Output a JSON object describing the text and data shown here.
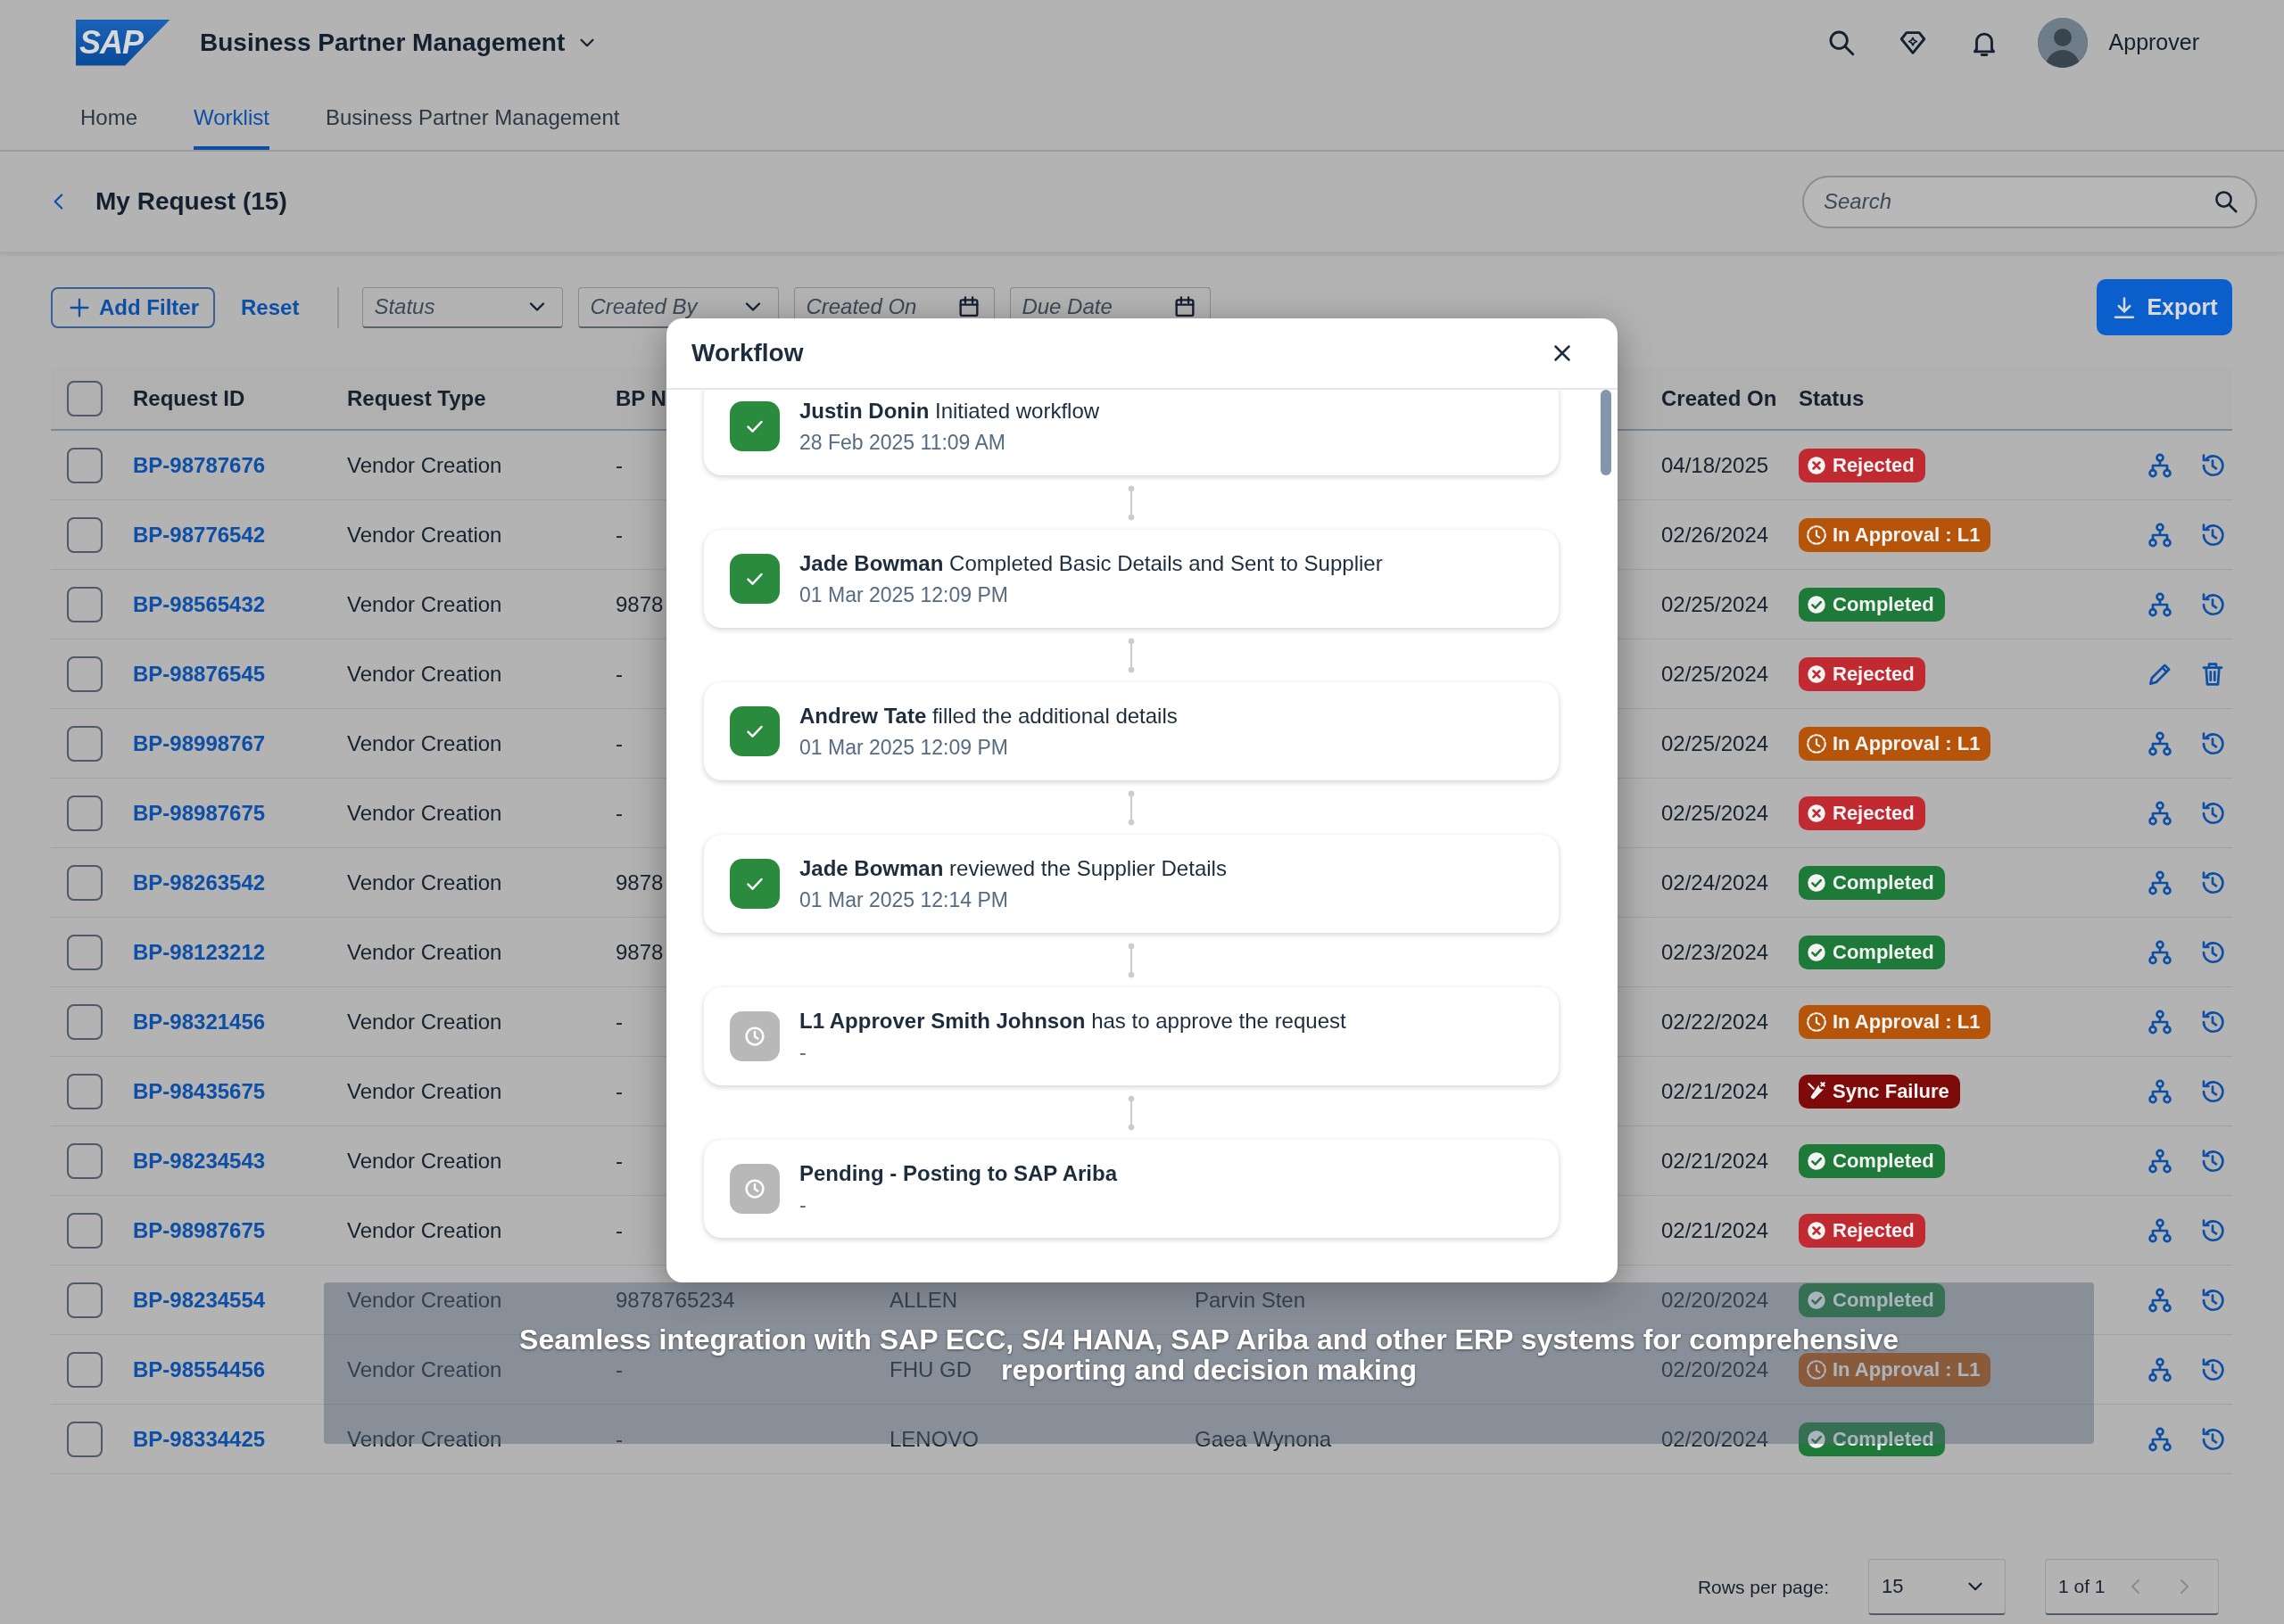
{
  "app": {
    "logo": "SAP",
    "title": "Business Partner Management",
    "user": "Approver"
  },
  "nav_tabs": [
    {
      "label": "Home",
      "selected": false
    },
    {
      "label": "Worklist",
      "selected": true
    },
    {
      "label": "Business Partner Management",
      "selected": false
    }
  ],
  "page": {
    "title": "My Request (15)"
  },
  "search": {
    "placeholder": "Search"
  },
  "filters": {
    "add_filter": "Add Filter",
    "reset": "Reset",
    "export": "Export",
    "fields": [
      {
        "kind": "select",
        "placeholder": "Status"
      },
      {
        "kind": "select",
        "placeholder": "Created By"
      },
      {
        "kind": "date",
        "placeholder": "Created On"
      },
      {
        "kind": "date",
        "placeholder": "Due Date"
      }
    ]
  },
  "table": {
    "all_checked": false,
    "columns": {
      "request_id": "Request ID",
      "request_type": "Request Type",
      "column_3": "BP N",
      "created_on": "Created On",
      "status": "Status"
    },
    "rows": [
      {
        "checked": false,
        "request_id": "BP-98787676",
        "request_type": "Vendor Creation",
        "column_3": "-",
        "created_on": "04/18/2025",
        "status": {
          "label": "Rejected",
          "kind": "rejected"
        },
        "actions": [
          {
            "kind": "hierarchy"
          },
          {
            "kind": "history"
          }
        ]
      },
      {
        "checked": false,
        "request_id": "BP-98776542",
        "request_type": "Vendor Creation",
        "column_3": "-",
        "created_on": "02/26/2024",
        "status": {
          "label": "In Approval : L1",
          "kind": "in_approval"
        },
        "actions": [
          {
            "kind": "hierarchy"
          },
          {
            "kind": "history"
          }
        ]
      },
      {
        "checked": false,
        "request_id": "BP-98565432",
        "request_type": "Vendor Creation",
        "column_3": "9878",
        "created_on": "02/25/2024",
        "status": {
          "label": "Completed",
          "kind": "completed"
        },
        "actions": [
          {
            "kind": "hierarchy"
          },
          {
            "kind": "history"
          }
        ]
      },
      {
        "checked": false,
        "request_id": "BP-98876545",
        "request_type": "Vendor Creation",
        "column_3": "-",
        "created_on": "02/25/2024",
        "status": {
          "label": "Rejected",
          "kind": "rejected"
        },
        "actions": [
          {
            "kind": "edit"
          },
          {
            "kind": "delete"
          }
        ]
      },
      {
        "checked": false,
        "request_id": "BP-98998767",
        "request_type": "Vendor Creation",
        "column_3": "-",
        "created_on": "02/25/2024",
        "status": {
          "label": "In Approval : L1",
          "kind": "in_approval"
        },
        "actions": [
          {
            "kind": "hierarchy"
          },
          {
            "kind": "history"
          }
        ]
      },
      {
        "checked": false,
        "request_id": "BP-98987675",
        "request_type": "Vendor Creation",
        "column_3": "-",
        "created_on": "02/25/2024",
        "status": {
          "label": "Rejected",
          "kind": "rejected"
        },
        "actions": [
          {
            "kind": "hierarchy"
          },
          {
            "kind": "history"
          }
        ]
      },
      {
        "checked": false,
        "request_id": "BP-98263542",
        "request_type": "Vendor Creation",
        "column_3": "9878",
        "created_on": "02/24/2024",
        "status": {
          "label": "Completed",
          "kind": "completed"
        },
        "actions": [
          {
            "kind": "hierarchy"
          },
          {
            "kind": "history"
          }
        ]
      },
      {
        "checked": false,
        "request_id": "BP-98123212",
        "request_type": "Vendor Creation",
        "column_3": "9878",
        "created_on": "02/23/2024",
        "status": {
          "label": "Completed",
          "kind": "completed"
        },
        "actions": [
          {
            "kind": "hierarchy"
          },
          {
            "kind": "history"
          }
        ]
      },
      {
        "checked": false,
        "request_id": "BP-98321456",
        "request_type": "Vendor Creation",
        "column_3": "-",
        "created_on": "02/22/2024",
        "status": {
          "label": "In Approval : L1",
          "kind": "in_approval"
        },
        "actions": [
          {
            "kind": "hierarchy"
          },
          {
            "kind": "history"
          }
        ]
      },
      {
        "checked": false,
        "request_id": "BP-98435675",
        "request_type": "Vendor Creation",
        "column_3": "-",
        "created_on": "02/21/2024",
        "status": {
          "label": "Sync Failure",
          "kind": "sync_failure"
        },
        "actions": [
          {
            "kind": "hierarchy"
          },
          {
            "kind": "history"
          }
        ]
      },
      {
        "checked": false,
        "request_id": "BP-98234543",
        "request_type": "Vendor Creation",
        "column_3": "-",
        "created_on": "02/21/2024",
        "status": {
          "label": "Completed",
          "kind": "completed"
        },
        "actions": [
          {
            "kind": "hierarchy"
          },
          {
            "kind": "history"
          }
        ]
      },
      {
        "checked": false,
        "request_id": "BP-98987675",
        "request_type": "Vendor Creation",
        "column_3": "-",
        "created_on": "02/21/2024",
        "status": {
          "label": "Rejected",
          "kind": "rejected"
        },
        "actions": [
          {
            "kind": "hierarchy"
          },
          {
            "kind": "history"
          }
        ]
      },
      {
        "checked": false,
        "request_id": "BP-98234554",
        "request_type": "Vendor Creation",
        "column_3": "9878765234",
        "column_4": "ALLEN",
        "column_5": "Parvin Sten",
        "created_on": "02/20/2024",
        "status": {
          "label": "Completed",
          "kind": "completed"
        },
        "actions": [
          {
            "kind": "hierarchy"
          },
          {
            "kind": "history"
          }
        ]
      },
      {
        "checked": false,
        "request_id": "BP-98554456",
        "request_type": "Vendor Creation",
        "column_3": "-",
        "column_4": "FHU GD",
        "created_on": "02/20/2024",
        "status": {
          "label": "In Approval : L1",
          "kind": "in_approval"
        },
        "actions": [
          {
            "kind": "hierarchy"
          },
          {
            "kind": "history"
          }
        ]
      },
      {
        "checked": false,
        "request_id": "BP-98334425",
        "request_type": "Vendor Creation",
        "column_3": "-",
        "column_4": "LENOVO",
        "column_5": "Gaea Wynona",
        "created_on": "02/20/2024",
        "status": {
          "label": "Completed",
          "kind": "completed"
        },
        "actions": [
          {
            "kind": "hierarchy"
          },
          {
            "kind": "history"
          }
        ]
      }
    ]
  },
  "pagination": {
    "rows_per_page_label": "Rows per page:",
    "rows_per_page": "15",
    "page": "1 of 1",
    "previous_disabled": true,
    "next_disabled": true
  },
  "workflow_dialog": {
    "title": "Workflow",
    "steps": [
      {
        "kind": "done",
        "actor": "Justin Donin",
        "action": "Initiated workflow",
        "time": "28 Feb 2025 11:09 AM"
      },
      {
        "kind": "done",
        "actor": "Jade Bowman",
        "action": "Completed Basic Details and Sent to Supplier",
        "time": "01 Mar 2025 12:09 PM"
      },
      {
        "kind": "done",
        "actor": "Andrew Tate",
        "action": "filled the additional details",
        "time": "01 Mar 2025 12:09 PM"
      },
      {
        "kind": "done",
        "actor": "Jade Bowman",
        "action": "reviewed the Supplier Details",
        "time": "01 Mar 2025 12:14 PM"
      },
      {
        "kind": "pending",
        "actor": "L1 Approver Smith Johnson",
        "action": "has to approve the request",
        "time": "-"
      },
      {
        "kind": "pending",
        "actor": "Pending - Posting to SAP Ariba",
        "time": "-"
      }
    ]
  },
  "caption": {
    "lines": [
      "Seamless integration with SAP ECC, S/4 HANA, SAP Ariba and other ERP systems for comprehensive",
      "reporting and decision making"
    ]
  }
}
